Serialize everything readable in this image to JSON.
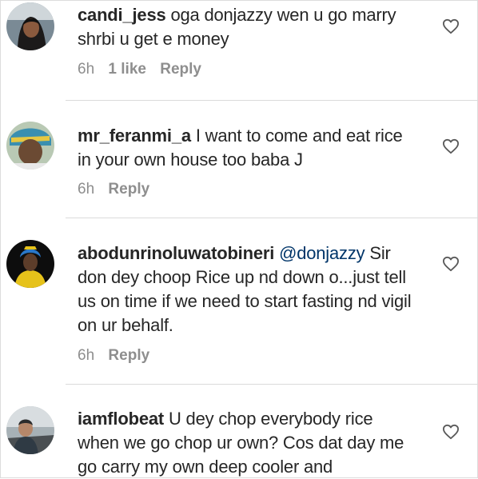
{
  "comments": [
    {
      "username": "candi_jess",
      "text": "oga donjazzy wen u go marry shrbi u get e money",
      "time": "6h",
      "likes": "1 like",
      "reply": "Reply",
      "avatar_icon": "woman-avatar"
    },
    {
      "username": "mr_feranmi_a",
      "text": "I want to come and eat rice in your own house too baba J",
      "time": "6h",
      "reply": "Reply",
      "avatar_icon": "man-avatar"
    },
    {
      "username": "abodunrinoluwatobineri",
      "mention": "@donjazzy",
      "text": "Sir don dey choop Rice up nd down o...just tell us on time if we need to start fasting nd vigil on ur behalf.",
      "time": "6h",
      "reply": "Reply",
      "avatar_icon": "woman-yellow-avatar"
    },
    {
      "username": "iamflobeat",
      "text": "U dey chop everybody rice when we go chop ur own? Cos dat day me go carry my own deep cooler and",
      "avatar_icon": "man-car-avatar"
    }
  ]
}
